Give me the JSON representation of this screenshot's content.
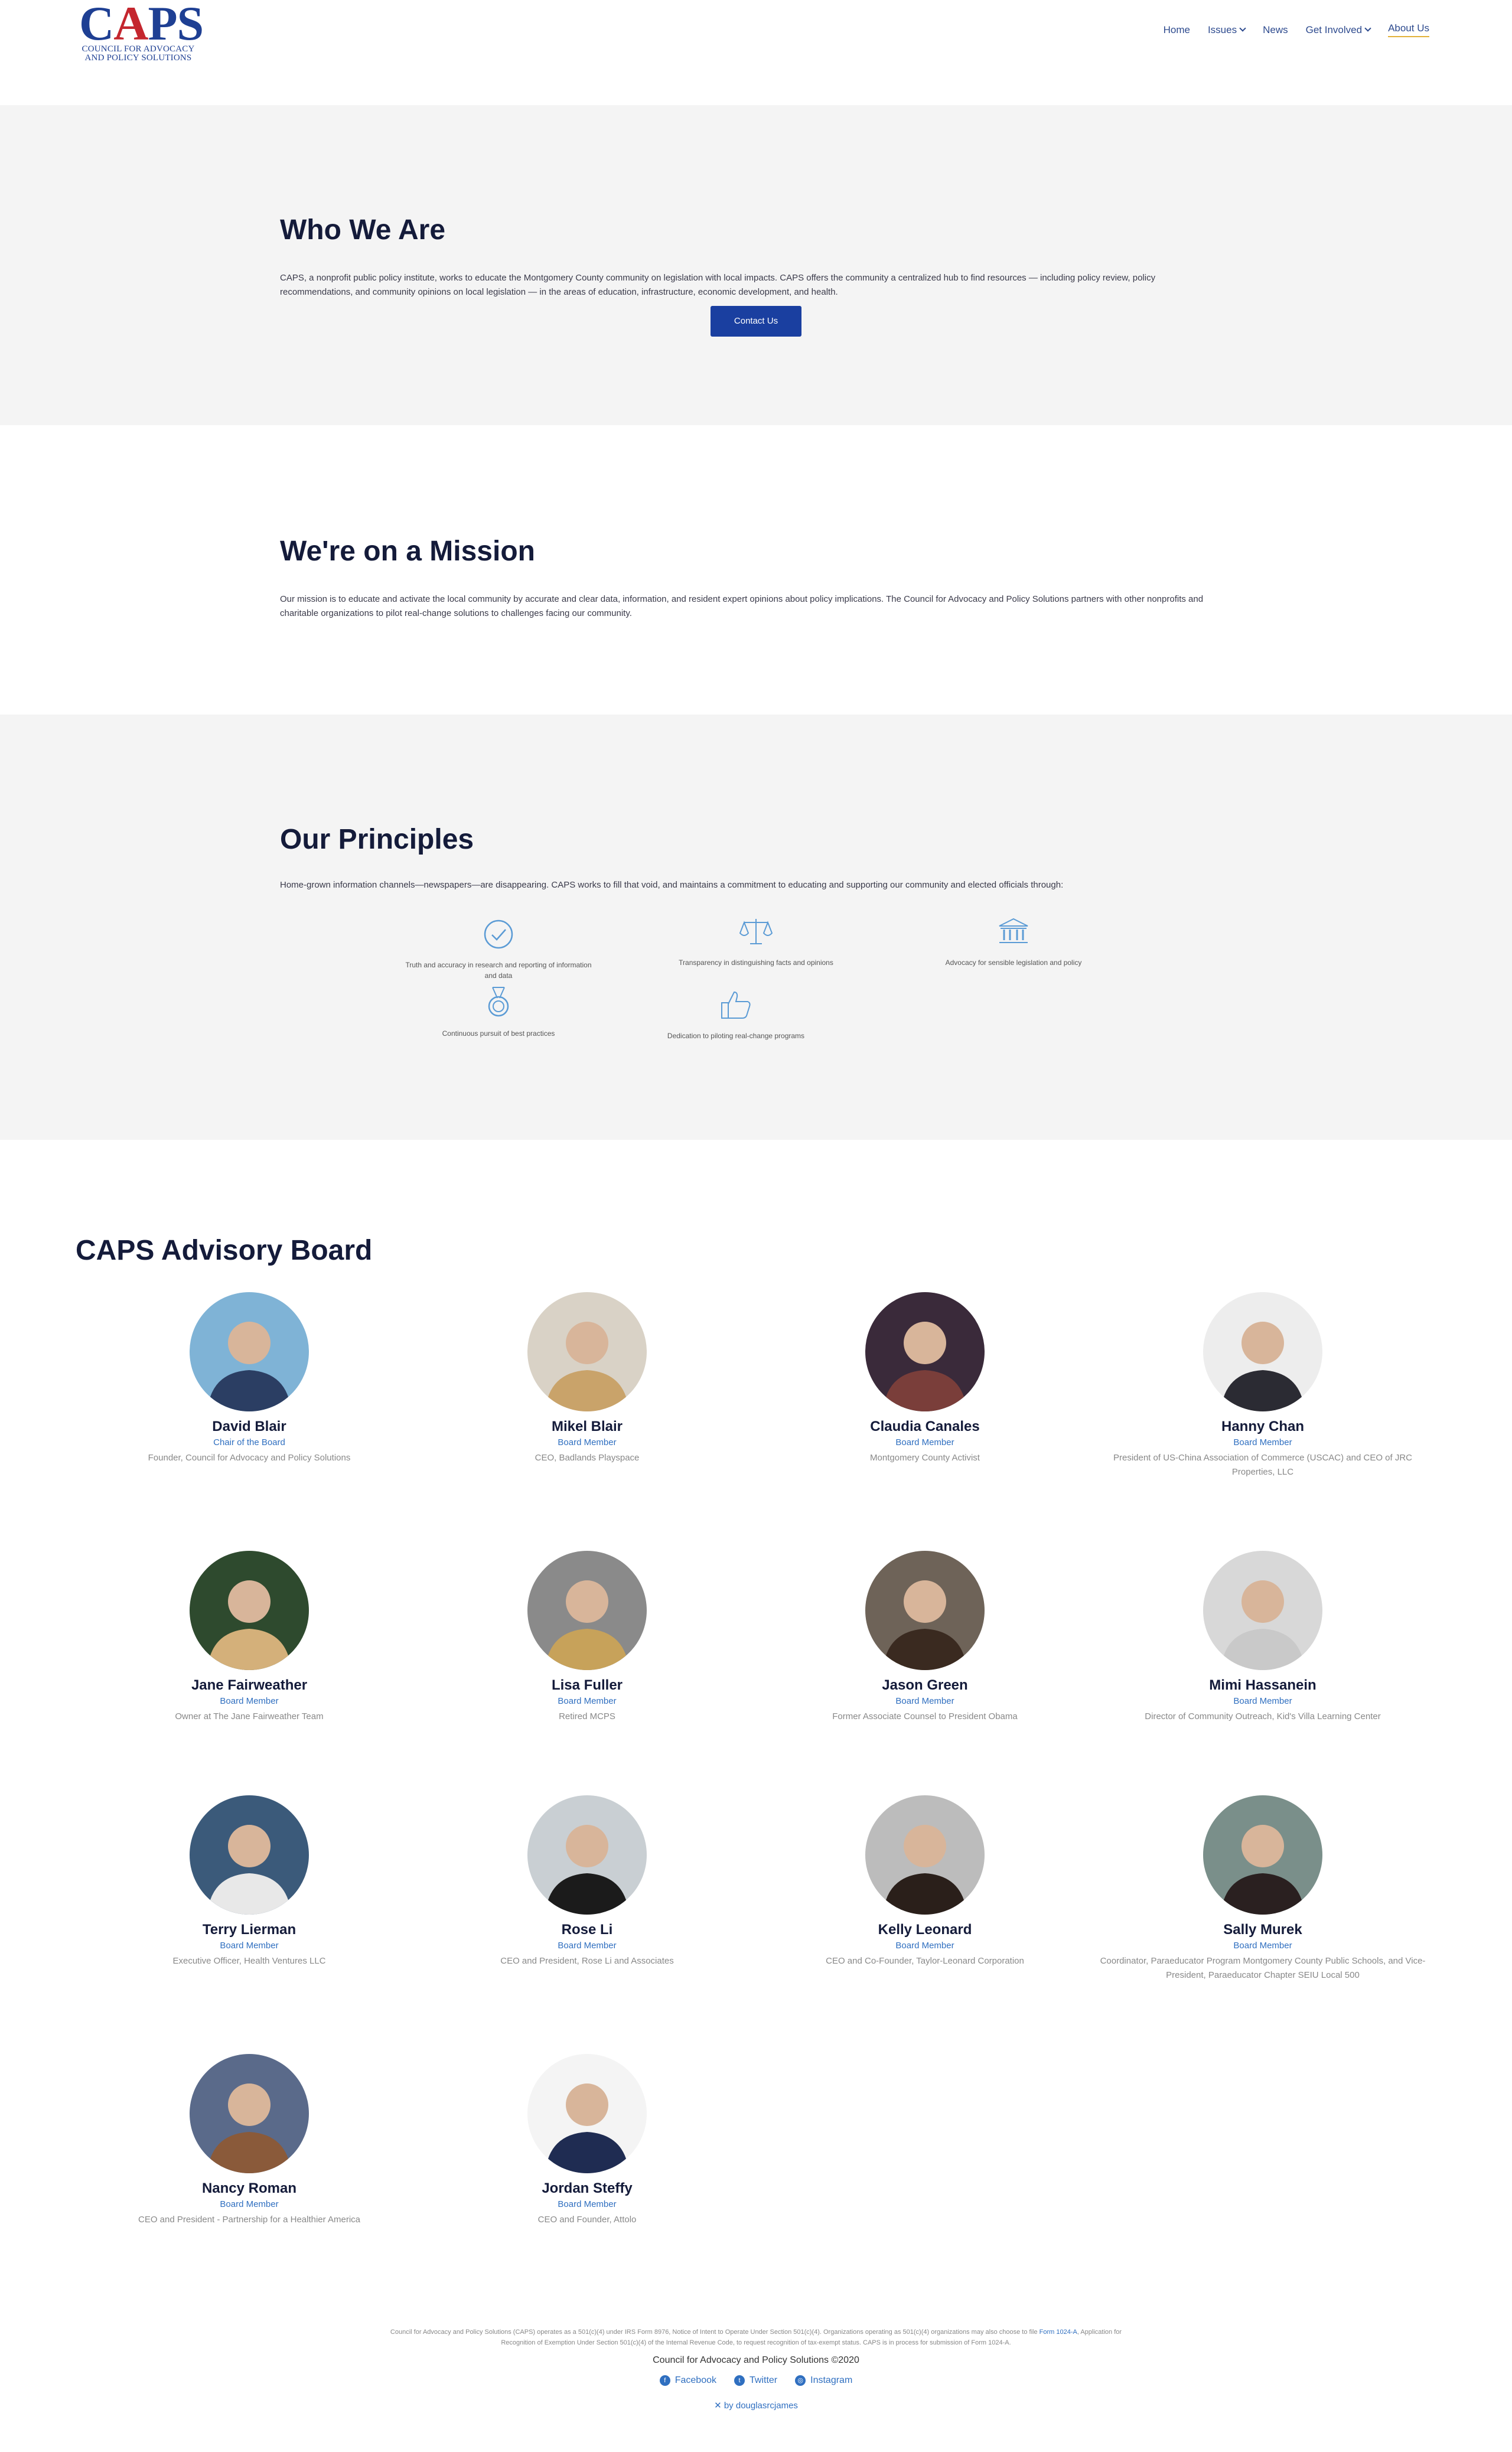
{
  "header": {
    "logo_text": "CAPS",
    "logo_sub_line1": "COUNCIL FOR ADVOCACY",
    "logo_sub_line2": "AND POLICY SOLUTIONS",
    "nav": [
      {
        "label": "Home"
      },
      {
        "label": "Issues"
      },
      {
        "label": "News"
      },
      {
        "label": "Get Involved"
      },
      {
        "label": "About Us"
      }
    ]
  },
  "who": {
    "title": "Who We Are",
    "body": "CAPS, a nonprofit public policy institute, works to educate the Montgomery County community on legislation with local impacts. CAPS offers the community a centralized hub to find resources — including policy review, policy recommendations, and community opinions on local legislation — in the areas of education, infrastructure, economic development, and health.",
    "button": "Contact Us"
  },
  "mission": {
    "title": "We're on a Mission",
    "body": "Our mission is to educate and activate the local community by accurate and clear data, information, and resident expert opinions about policy implications.  The Council for Advocacy and Policy Solutions partners with other nonprofits and charitable organizations to pilot real-change solutions to challenges facing our community."
  },
  "principles": {
    "title": "Our Principles",
    "body": "Home-grown information channels—newspapers—are disappearing. CAPS works to fill that void, and maintains a commitment to educating and supporting our community and elected officials through:",
    "items": [
      {
        "icon": "check-circle-icon",
        "caption": "Truth and accuracy in research and reporting of information and data"
      },
      {
        "icon": "scales-icon",
        "caption": "Transparency in distinguishing facts and opinions"
      },
      {
        "icon": "bank-icon",
        "caption": "Advocacy for sensible legislation and policy"
      },
      {
        "icon": "medal-icon",
        "caption": "Continuous pursuit of best practices"
      },
      {
        "icon": "thumbs-up-icon",
        "caption": "Dedication to piloting real-change programs"
      }
    ]
  },
  "board": {
    "title": "CAPS Advisory Board",
    "members": [
      {
        "name": "David Blair",
        "role": "Chair of the Board",
        "desc": "Founder, Council for Advocacy and Policy Solutions"
      },
      {
        "name": "Mikel Blair",
        "role": "Board Member",
        "desc": "CEO, Badlands Playspace"
      },
      {
        "name": "Claudia Canales",
        "role": "Board Member",
        "desc": "Montgomery County Activist"
      },
      {
        "name": "Hanny Chan",
        "role": "Board Member",
        "desc": "President of US-China Association of Commerce (USCAC) and CEO of JRC Properties, LLC"
      },
      {
        "name": "Jane Fairweather",
        "role": "Board Member",
        "desc": "Owner at The Jane Fairweather Team"
      },
      {
        "name": "Lisa Fuller",
        "role": "Board Member",
        "desc": "Retired MCPS"
      },
      {
        "name": "Jason Green",
        "role": "Board Member",
        "desc": "Former Associate Counsel to President Obama"
      },
      {
        "name": "Mimi Hassanein",
        "role": "Board Member",
        "desc": "Director of Community Outreach, Kid's Villa Learning Center"
      },
      {
        "name": "Terry Lierman",
        "role": "Board Member",
        "desc": "Executive Officer, Health Ventures LLC"
      },
      {
        "name": "Rose Li",
        "role": "Board Member",
        "desc": "CEO and President, Rose Li and Associates"
      },
      {
        "name": "Kelly Leonard",
        "role": "Board Member",
        "desc": "CEO and Co-Founder, Taylor-Leonard Corporation"
      },
      {
        "name": "Sally Murek",
        "role": "Board Member",
        "desc": "Coordinator, Paraeducator Program Montgomery County Public Schools, and Vice-President, Paraeducator Chapter SEIU Local 500"
      },
      {
        "name": "Nancy Roman",
        "role": "Board Member",
        "desc": "CEO and President - Partnership for a Healthier America"
      },
      {
        "name": "Jordan Steffy",
        "role": "Board Member",
        "desc": "CEO and Founder, Attolo"
      }
    ]
  },
  "footer": {
    "legal_a": "Council for Advocacy and Policy Solutions (CAPS) operates as a 501(c)(4) under IRS Form 8976, Notice of Intent to Operate Under Section 501(c)(4). Organizations operating as 501(c)(4) organizations may also choose to file ",
    "legal_link": "Form 1024-A",
    "legal_b": ", Application for Recognition of Exemption Under Section 501(c)(4) of the Internal Revenue Code, to request recognition of tax-exempt status. CAPS is in process for submission of Form 1024-A.",
    "copyright": "Council for Advocacy and Policy Solutions   ©2020",
    "social": [
      {
        "icon": "facebook-icon",
        "glyph": "f",
        "label": "Facebook"
      },
      {
        "icon": "twitter-icon",
        "glyph": "t",
        "label": "Twitter"
      },
      {
        "icon": "instagram-icon",
        "glyph": "◎",
        "label": "Instagram"
      }
    ],
    "credit": "by douglasrcjames"
  },
  "colors": {
    "brand_blue": "#1e3f93",
    "brand_red": "#c4262e",
    "button_blue": "#1a3fa0",
    "link_blue": "#2f6fc0",
    "nav_underline": "#e2b23a",
    "band_gray": "#f4f4f4"
  }
}
